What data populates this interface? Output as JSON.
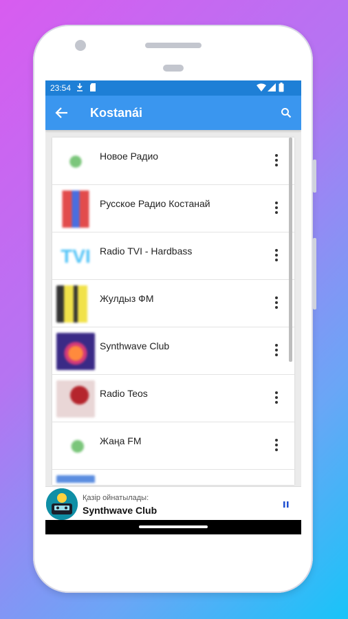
{
  "status_bar": {
    "time": "23:54"
  },
  "app_bar": {
    "title": "Kostanái"
  },
  "stations": [
    {
      "name": "Новое Радио",
      "logo": "novoe-radio-logo"
    },
    {
      "name": "Русское Радио Костанай",
      "logo": "russkoe-radio-logo"
    },
    {
      "name": "Radio TVI - Hardbass",
      "logo": "tvi-logo"
    },
    {
      "name": "Жулдыз ФМ",
      "logo": "zhuldyz-logo"
    },
    {
      "name": "Synthwave Club",
      "logo": "synthwave-logo"
    },
    {
      "name": "Radio Teos",
      "logo": "teos-logo"
    },
    {
      "name": "Жаңа FM",
      "logo": "zhana-fm-logo"
    },
    {
      "name": "",
      "logo": "partial-logo"
    }
  ],
  "now_playing": {
    "label": "Қазір ойнатылады:",
    "track": "Synthwave Club"
  },
  "colors": {
    "status_bar": "#1e7fd6",
    "app_bar": "#3a96ef"
  }
}
